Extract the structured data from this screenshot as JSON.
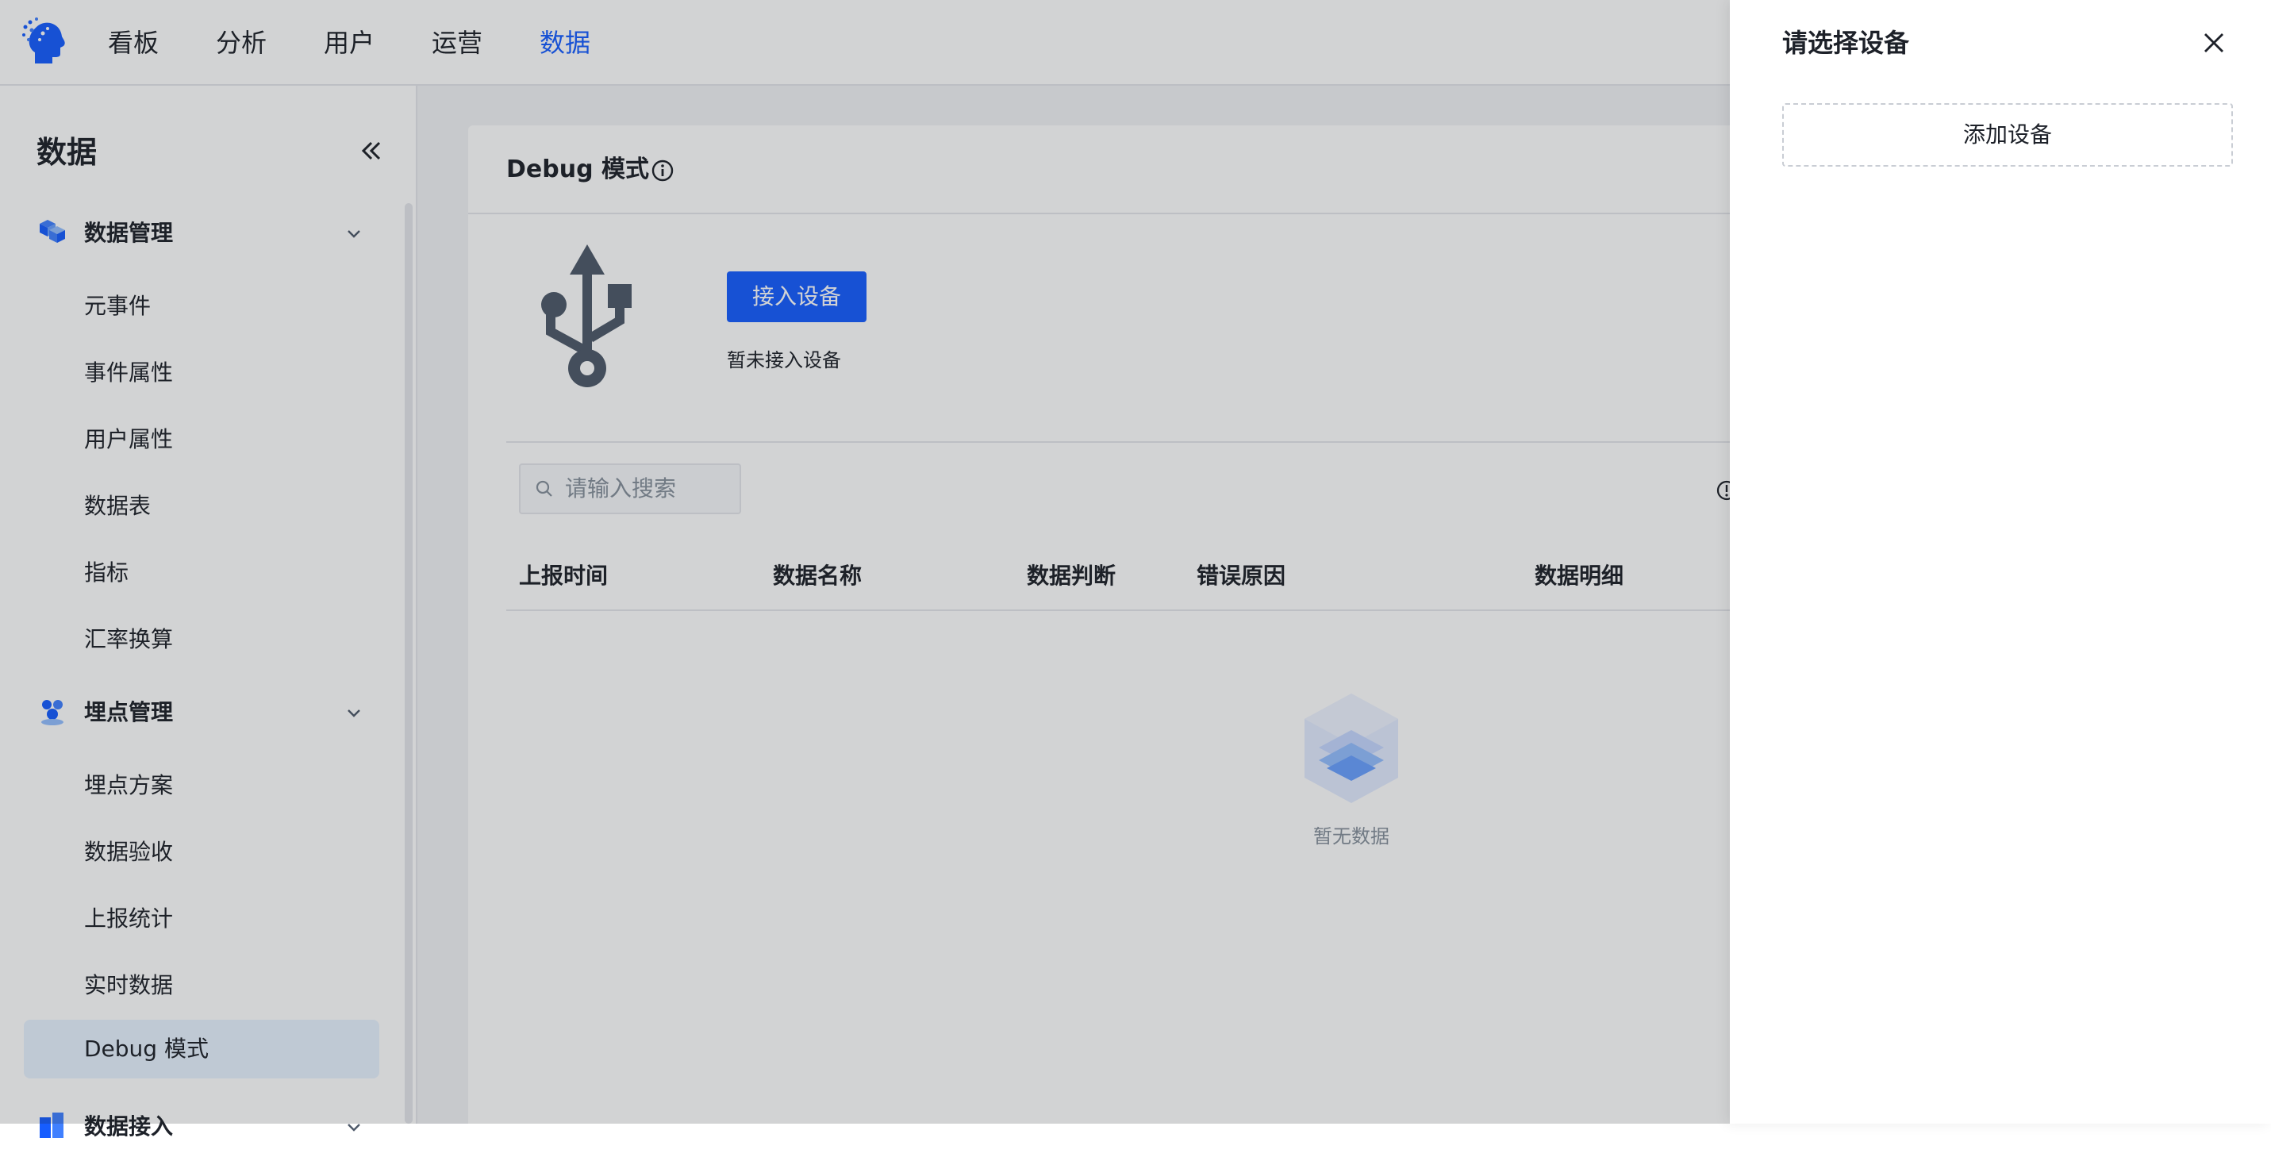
{
  "nav": {
    "items": [
      {
        "label": "看板"
      },
      {
        "label": "分析"
      },
      {
        "label": "用户"
      },
      {
        "label": "运营"
      },
      {
        "label": "数据",
        "active": true
      }
    ]
  },
  "sidebar": {
    "title": "数据",
    "groups": [
      {
        "label": "数据管理",
        "icon": "cubes-icon",
        "items": [
          "元事件",
          "事件属性",
          "用户属性",
          "数据表",
          "指标",
          "汇率换算"
        ]
      },
      {
        "label": "埋点管理",
        "icon": "users-group-icon",
        "items": [
          "埋点方案",
          "数据验收",
          "上报统计",
          "实时数据",
          "Debug 模式"
        ],
        "active_item": "Debug 模式"
      },
      {
        "label": "数据接入",
        "icon": "data-import-icon",
        "items": []
      }
    ]
  },
  "main": {
    "title": "Debug 模式",
    "connect_button": "接入设备",
    "no_device_text": "暂未接入设备",
    "search_placeholder": "请输入搜索",
    "columns": [
      "上报时间",
      "数据名称",
      "数据判断",
      "错误原因",
      "数据明细"
    ],
    "empty_text": "暂无数据"
  },
  "drawer": {
    "title": "请选择设备",
    "add_button": "添加设备"
  },
  "colors": {
    "accent": "#165dff",
    "text": "#1d2129",
    "muted": "#86909c",
    "active_bg": "#e8f3ff",
    "overlay": "rgba(29,33,41,0.2)"
  }
}
